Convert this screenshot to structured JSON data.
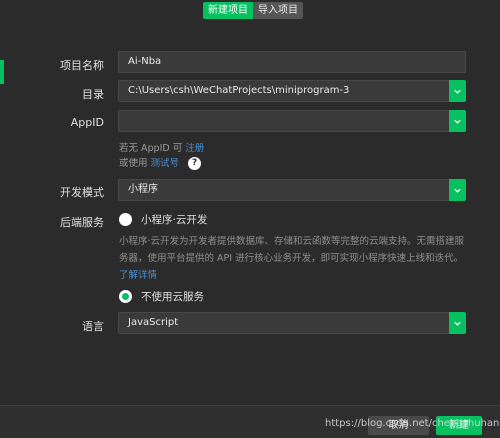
{
  "tabs": [
    {
      "label": "新建项目",
      "active": true
    },
    {
      "label": "导入项目",
      "active": false
    }
  ],
  "form": {
    "project_name": {
      "label": "项目名称",
      "value": "Ai-Nba"
    },
    "directory": {
      "label": "目录",
      "value": "C:\\Users\\csh\\WeChatProjects\\miniprogram-3"
    },
    "appid": {
      "label": "AppID",
      "value": "",
      "hint_prefix": "若无 AppID 可",
      "hint_link": "注册",
      "hint2_prefix": "或使用",
      "hint2_link": "测试号",
      "help_symbol": "?"
    },
    "dev_mode": {
      "label": "开发模式",
      "value": "小程序"
    },
    "backend": {
      "label": "后端服务",
      "option_cloud": "小程序·云开发",
      "description": "小程序·云开发为开发者提供数据库、存储和云函数等完整的云端支持。无需搭建服务器，使用平台提供的 API 进行核心业务开发，即可实现小程序快速上线和迭代。",
      "learn_more": "了解详情",
      "option_no_cloud": "不使用云服务",
      "selected": "不使用云服务"
    },
    "language": {
      "label": "语言",
      "value": "JavaScript"
    }
  },
  "footer": {
    "cancel_label": "取消",
    "create_label": "新建",
    "watermark": "https://blog.csdn.net/chengshuhang"
  },
  "colors": {
    "accent": "#07c160",
    "background": "#2b2b2b",
    "link": "#4d8fd6"
  }
}
